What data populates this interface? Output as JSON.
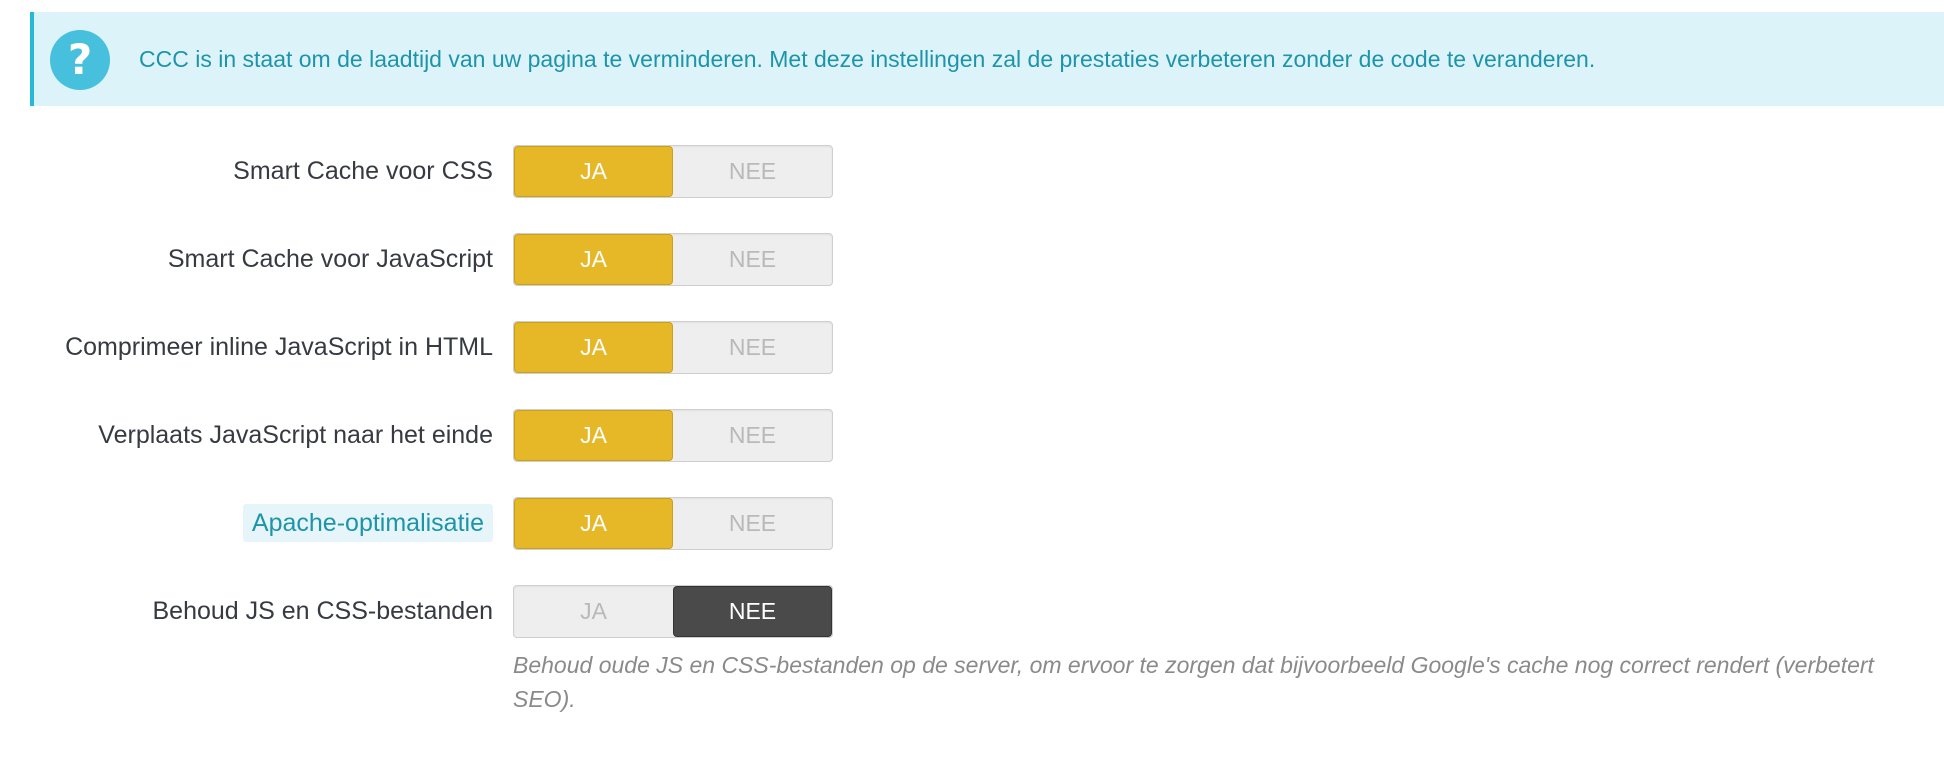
{
  "alert": {
    "icon": "question-icon",
    "icon_glyph": "?",
    "text": "CCC is in staat om de laadtijd van uw pagina te verminderen. Met deze instellingen zal de prestaties verbeteren zonder de code te veranderen.",
    "colors": {
      "background": "#dcf4f9",
      "accent": "#25b9d7",
      "text": "#1e94ab"
    }
  },
  "switch_colors": {
    "active_yes": "#e6b727",
    "active_no": "#4a4a4a",
    "inactive": "#eeeeee"
  },
  "settings": [
    {
      "label": "Smart Cache voor CSS",
      "yes_label": "JA",
      "no_label": "NEE",
      "value": "JA"
    },
    {
      "label": "Smart Cache voor JavaScript",
      "yes_label": "JA",
      "no_label": "NEE",
      "value": "JA"
    },
    {
      "label": "Comprimeer inline JavaScript in HTML",
      "yes_label": "JA",
      "no_label": "NEE",
      "value": "JA"
    },
    {
      "label": "Verplaats JavaScript naar het einde",
      "yes_label": "JA",
      "no_label": "NEE",
      "value": "JA"
    },
    {
      "label": "Apache-optimalisatie",
      "yes_label": "JA",
      "no_label": "NEE",
      "value": "JA"
    },
    {
      "label": "Behoud JS en CSS-bestanden",
      "yes_label": "JA",
      "no_label": "NEE",
      "value": "NEE"
    }
  ],
  "help_text": "Behoud oude JS en CSS-bestanden op de server, om ervoor te zorgen dat bijvoorbeeld Google's cache nog correct rendert (verbetert SEO)."
}
